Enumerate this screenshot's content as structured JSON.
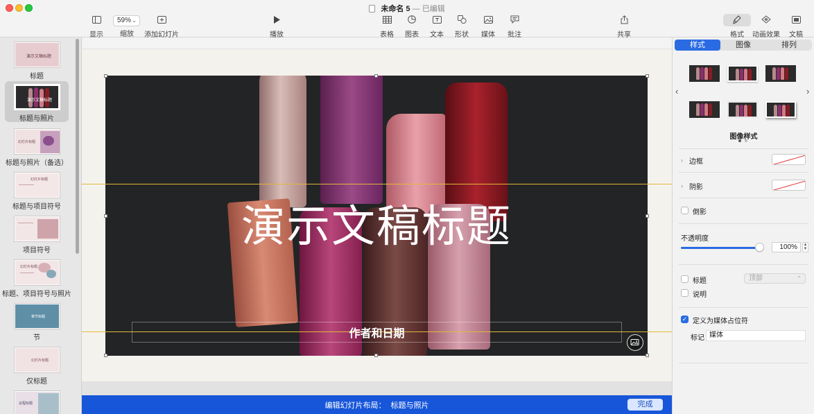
{
  "window": {
    "doc_name": "未命名 5",
    "dash": "—",
    "status": "已编辑"
  },
  "toolbar": {
    "view_label": "显示",
    "zoom_value": "59%",
    "zoom_label": "缩放",
    "add_slide_label": "添加幻灯片",
    "play_label": "播放",
    "table_label": "表格",
    "chart_label": "图表",
    "text_label": "文本",
    "shape_label": "形状",
    "media_label": "媒体",
    "comment_label": "批注",
    "share_label": "共享",
    "format_label": "格式",
    "animate_label": "动画效果",
    "document_label": "文稿"
  },
  "navigator": {
    "layouts": [
      {
        "label": "标题",
        "thumb_text": "演示文稿标题"
      },
      {
        "label": "标题与照片",
        "thumb_text": "演示文稿标题"
      },
      {
        "label": "标题与照片（备选）",
        "thumb_text": "幻灯片标题"
      },
      {
        "label": "标题与项目符号",
        "thumb_text": "幻灯片标题"
      },
      {
        "label": "项目符号",
        "thumb_text": ""
      },
      {
        "label": "标题、项目符号与照片",
        "thumb_text": "幻灯片标题"
      },
      {
        "label": "节",
        "thumb_text": "章节标题"
      },
      {
        "label": "仅标题",
        "thumb_text": "幻灯片标题"
      },
      {
        "label": "",
        "thumb_text": "议程标题"
      }
    ]
  },
  "slide": {
    "title": "演示文稿标题",
    "subtitle": "作者和日期"
  },
  "edit_bar": {
    "label": "编辑幻灯片布局：",
    "layout_name": "标题与照片",
    "done_label": "完成"
  },
  "inspector": {
    "tabs": [
      "样式",
      "图像",
      "排列"
    ],
    "style_caption": "图像样式",
    "border_label": "边框",
    "shadow_label": "阴影",
    "reflection_label": "倒影",
    "opacity_label": "不透明度",
    "opacity_value": "100%",
    "opacity_fraction": 1.0,
    "title_label": "标题",
    "title_position": "顶部",
    "caption_label": "说明",
    "media_placeholder_label": "定义为媒体占位符",
    "tag_label": "标记",
    "tag_value": "媒体"
  },
  "colors": {
    "accent": "#2a6be3",
    "edit_bar": "#1756d9",
    "guide": "#e2b93a"
  }
}
